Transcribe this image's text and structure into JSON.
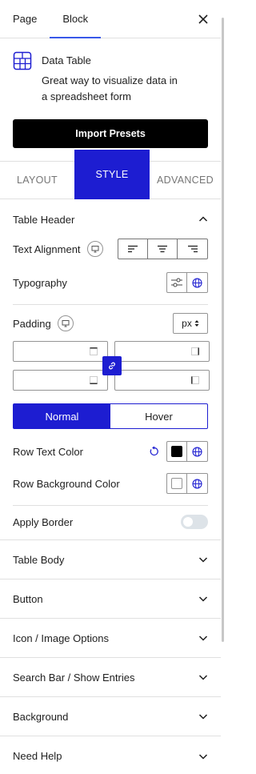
{
  "tabs": {
    "page": "Page",
    "block": "Block"
  },
  "block": {
    "title": "Data Table",
    "description": "Great way to visualize data in a spreadsheet form",
    "icon": "table-icon"
  },
  "import_button": "Import Presets",
  "style_tabs": {
    "layout": "LAYOUT",
    "style": "STYLE",
    "advanced": "ADVANCED"
  },
  "table_header": {
    "title": "Table Header",
    "text_alignment": "Text Alignment",
    "typography": "Typography",
    "padding": "Padding",
    "unit": "px",
    "state_tabs": {
      "normal": "Normal",
      "hover": "Hover"
    },
    "row_text_color": "Row Text Color",
    "row_text_color_value": "#000000",
    "row_bg_color": "Row Background Color",
    "apply_border": "Apply Border",
    "apply_border_enabled": false
  },
  "sections": [
    "Table Body",
    "Button",
    "Icon / Image Options",
    "Search Bar / Show Entries",
    "Background",
    "Need Help"
  ],
  "colors": {
    "accent": "#1d1dd1",
    "tab_underline": "#3858e9"
  }
}
